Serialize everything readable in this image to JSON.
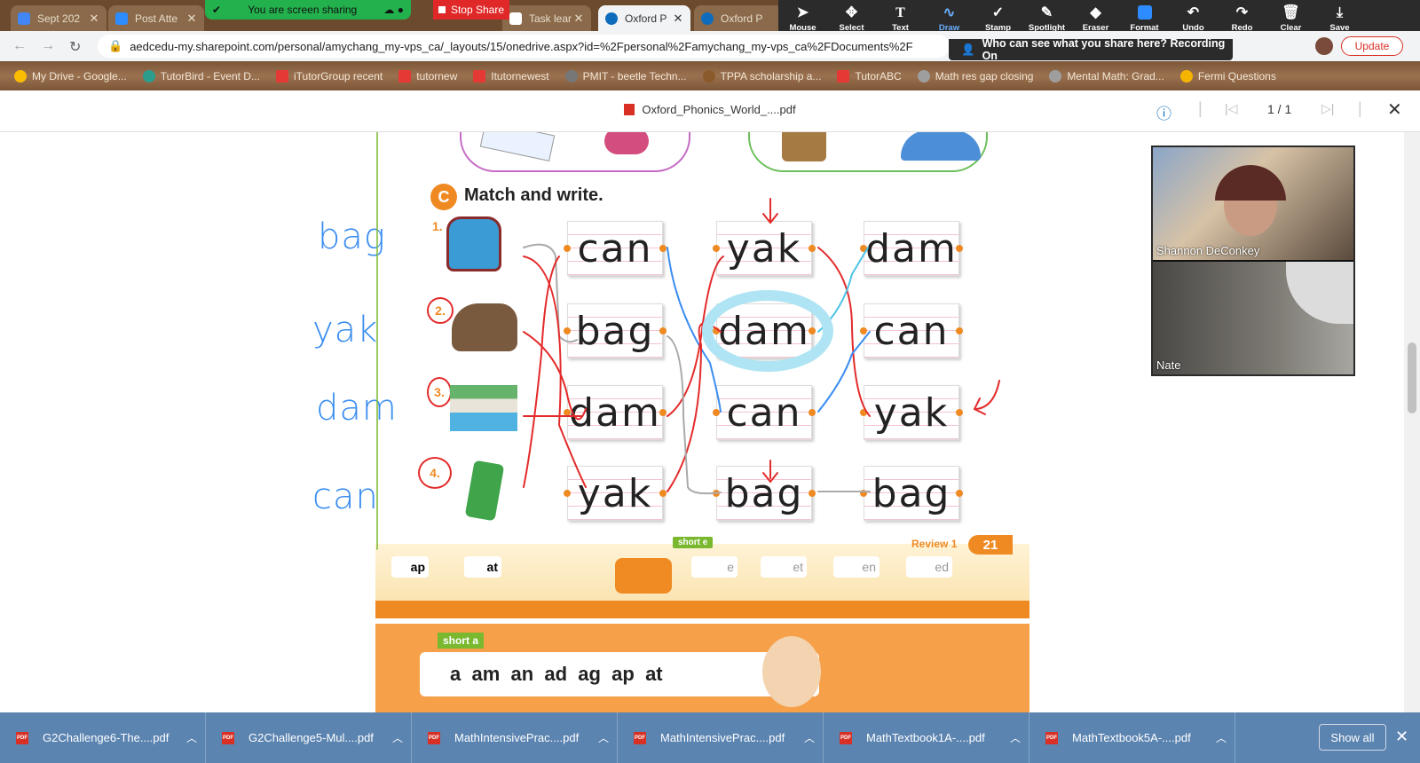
{
  "tabs": [
    {
      "label": "Sept 202",
      "color": "#4285f4"
    },
    {
      "label": "Post Atte",
      "color": "#2d8cff"
    },
    {
      "label": "",
      "color": "#23b14d"
    },
    {
      "label": "Task lear",
      "color": "#ffffff"
    },
    {
      "label": "Oxford P",
      "color": "#0f6cbd",
      "active": true
    },
    {
      "label": "Oxford P",
      "color": "#0f6cbd"
    }
  ],
  "screen_share": {
    "sharing_label": "You are screen sharing",
    "stop_label": "Stop Share"
  },
  "annotate_tools": [
    {
      "label": "Mouse",
      "icon": "mouse-pointer-icon"
    },
    {
      "label": "Select",
      "icon": "select-icon"
    },
    {
      "label": "Text",
      "icon": "text-icon"
    },
    {
      "label": "Draw",
      "icon": "draw-icon",
      "selected": true
    },
    {
      "label": "Stamp",
      "icon": "stamp-icon"
    },
    {
      "label": "Spotlight",
      "icon": "spotlight-icon"
    },
    {
      "label": "Eraser",
      "icon": "eraser-icon"
    },
    {
      "label": "Format",
      "icon": "format-icon"
    },
    {
      "label": "Undo",
      "icon": "undo-icon"
    },
    {
      "label": "Redo",
      "icon": "redo-icon"
    },
    {
      "label": "Clear",
      "icon": "trash-icon"
    },
    {
      "label": "Save",
      "icon": "save-icon"
    }
  ],
  "share_notice": "Who can see what you share here? Recording On",
  "address": {
    "url": "aedcedu-my.sharepoint.com/personal/amychang_my-vps_ca/_layouts/15/onedrive.aspx?id=%2Fpersonal%2Famychang_my-vps_ca%2FDocuments%2F",
    "update_label": "Update"
  },
  "bookmarks": [
    {
      "label": "My Drive - Google...",
      "color": "#fbbc04"
    },
    {
      "label": "TutorBird - Event D...",
      "color": "#2a9d8f"
    },
    {
      "label": "iTutorGroup recent",
      "color": "#e53935"
    },
    {
      "label": "tutornew",
      "color": "#e53935"
    },
    {
      "label": "Itutornewest",
      "color": "#e53935"
    },
    {
      "label": "PMIT - beetle Techn...",
      "color": "#777777"
    },
    {
      "label": "TPPA scholarship a...",
      "color": "#8b5a2b"
    },
    {
      "label": "TutorABC",
      "color": "#e53935"
    },
    {
      "label": "Math res gap closing",
      "color": "#9e9e9e"
    },
    {
      "label": "Mental Math: Grad...",
      "color": "#9e9e9e"
    },
    {
      "label": "Fermi Questions",
      "color": "#f4b400"
    }
  ],
  "pdf": {
    "filename": "Oxford_Phonics_World_....pdf",
    "page_indicator": "1 / 1"
  },
  "worksheet": {
    "section_letter": "C",
    "title": "Match and write.",
    "numbers": [
      "1.",
      "2.",
      "3.",
      "4."
    ],
    "picture_names": [
      "backpack",
      "yak",
      "dam",
      "soda can"
    ],
    "columns": [
      [
        "can",
        "bag",
        "dam",
        "yak"
      ],
      [
        "yak",
        "dam",
        "can",
        "bag"
      ],
      [
        "dam",
        "can",
        "yak",
        "bag"
      ]
    ],
    "handwritten": [
      "bag",
      "yak",
      "dam",
      "can"
    ],
    "review_label": "Review 1",
    "page_number": "21",
    "train_top": [
      "ap",
      "at",
      "e",
      "et",
      "en",
      "ed"
    ],
    "train_flag": "short e",
    "short_a_label": "short a",
    "short_a_sounds": "a  am  an  ad  ag  ap  at"
  },
  "participants": [
    {
      "name": "Shannon DeConkey"
    },
    {
      "name": "Nate"
    }
  ],
  "downloads": [
    "G2Challenge6-The....pdf",
    "G2Challenge5-Mul....pdf",
    "MathIntensivePrac....pdf",
    "MathIntensivePrac....pdf",
    "MathTextbook1A-....pdf",
    "MathTextbook5A-....pdf"
  ],
  "downloads_show_all": "Show all"
}
